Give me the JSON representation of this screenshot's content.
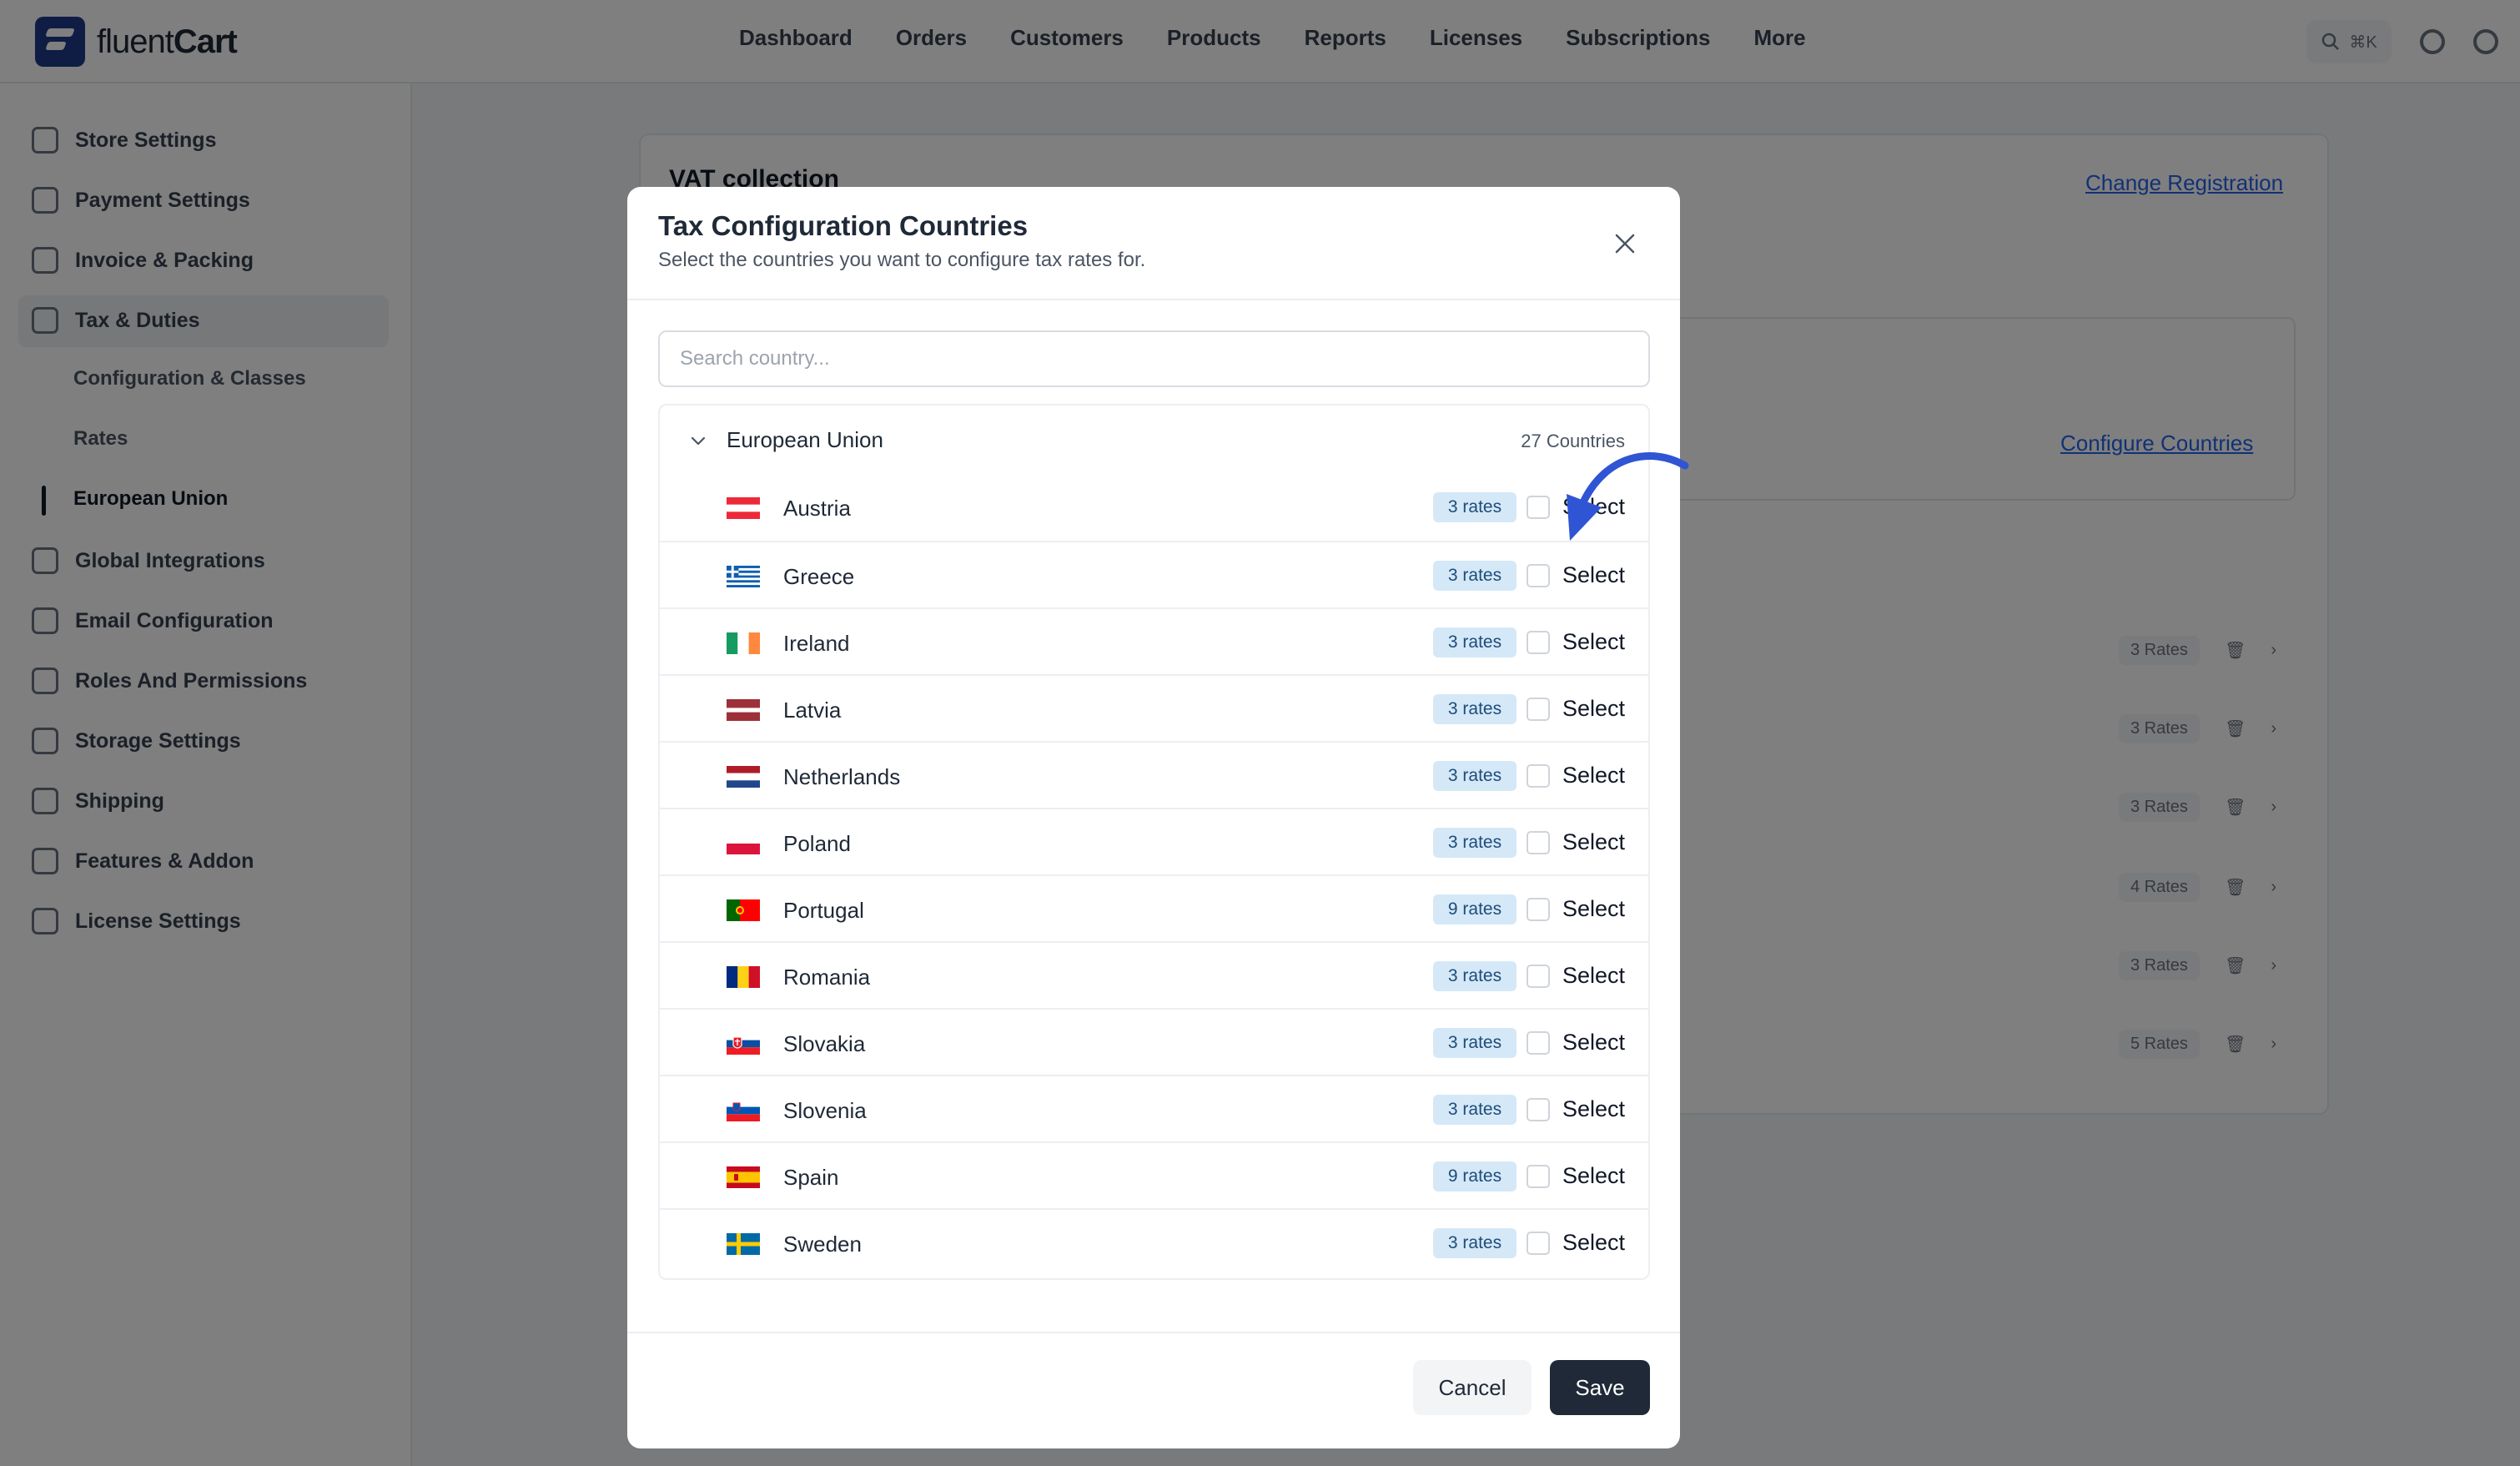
{
  "app": {
    "logo_text_regular": "fluent",
    "logo_text_bold": "Cart",
    "nav": [
      "Dashboard",
      "Orders",
      "Customers",
      "Products",
      "Reports",
      "Licenses",
      "Subscriptions",
      "More"
    ],
    "search_shortcut": "⌘K"
  },
  "sidebar": {
    "items": [
      {
        "label": "Store Settings",
        "icon": "store-icon"
      },
      {
        "label": "Payment Settings",
        "icon": "card-icon"
      },
      {
        "label": "Invoice & Packing",
        "icon": "invoice-icon"
      },
      {
        "label": "Tax & Duties",
        "icon": "tax-icon"
      },
      {
        "label": "Global Integrations",
        "icon": "integrations-icon"
      },
      {
        "label": "Email Configuration",
        "icon": "email-icon"
      },
      {
        "label": "Roles And Permissions",
        "icon": "roles-icon"
      },
      {
        "label": "Storage Settings",
        "icon": "storage-icon"
      },
      {
        "label": "Shipping",
        "icon": "shipping-icon"
      },
      {
        "label": "Features & Addon",
        "icon": "addon-icon"
      },
      {
        "label": "License Settings",
        "icon": "license-icon"
      }
    ],
    "sub_items": [
      "Configuration & Classes",
      "Rates",
      "European Union"
    ]
  },
  "background": {
    "title": "VAT collection",
    "change_link": "Change Registration",
    "configure_link": "Configure Countries",
    "rows": [
      "3 Rates",
      "3 Rates",
      "3 Rates",
      "4 Rates",
      "3 Rates",
      "5 Rates"
    ]
  },
  "modal": {
    "title": "Tax Configuration Countries",
    "subtitle": "Select the countries you want to configure tax rates for.",
    "search_placeholder": "Search country...",
    "group_name": "European Union",
    "group_count": "27 Countries",
    "select_label": "Select",
    "countries": [
      {
        "name": "Austria",
        "rates": "3 rates",
        "flag": "austria"
      },
      {
        "name": "Greece",
        "rates": "3 rates",
        "flag": "greece"
      },
      {
        "name": "Ireland",
        "rates": "3 rates",
        "flag": "ireland"
      },
      {
        "name": "Latvia",
        "rates": "3 rates",
        "flag": "latvia"
      },
      {
        "name": "Netherlands",
        "rates": "3 rates",
        "flag": "netherlands"
      },
      {
        "name": "Poland",
        "rates": "3 rates",
        "flag": "poland"
      },
      {
        "name": "Portugal",
        "rates": "9 rates",
        "flag": "portugal"
      },
      {
        "name": "Romania",
        "rates": "3 rates",
        "flag": "romania"
      },
      {
        "name": "Slovakia",
        "rates": "3 rates",
        "flag": "slovakia"
      },
      {
        "name": "Slovenia",
        "rates": "3 rates",
        "flag": "slovenia"
      },
      {
        "name": "Spain",
        "rates": "9 rates",
        "flag": "spain"
      },
      {
        "name": "Sweden",
        "rates": "3 rates",
        "flag": "sweden"
      }
    ],
    "cancel_label": "Cancel",
    "save_label": "Save"
  },
  "colors": {
    "accent_arrow": "#2f55d4",
    "save_button": "#1f2937",
    "badge_bg": "#d4e8f7"
  }
}
